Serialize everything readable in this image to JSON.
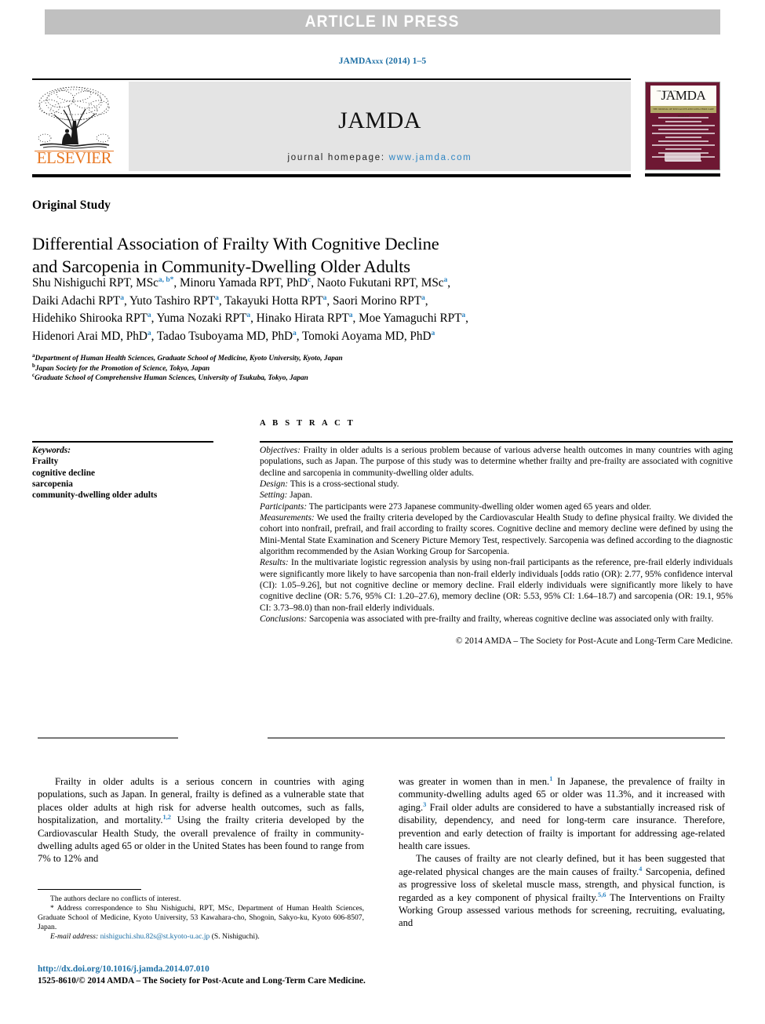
{
  "banner": {
    "text": "ARTICLE IN PRESS"
  },
  "citation": {
    "journal": "JAMDA",
    "volume": "xxx",
    "year": "(2014)",
    "pages": "1–5"
  },
  "masthead": {
    "publisher": "ELSEVIER",
    "journal_title": "JAMDA",
    "homepage_label": "journal homepage:",
    "homepage_url": "www.jamda.com"
  },
  "cover": {
    "title": "JAMDA",
    "top_caption": "THE JOURNAL OF",
    "band_caption": "THE JOURNAL OF POST-ACUTE AND LONG-TERM CARE MEDICINE",
    "logo_label": "jamda"
  },
  "article": {
    "section_type": "Original Study",
    "title_line1": "Differential Association of Frailty With Cognitive Decline",
    "title_line2": "and Sarcopenia in Community-Dwelling Older Adults"
  },
  "authors": {
    "line1_a": "Shu Nishiguchi RPT, MSc",
    "line1_a_sup": "a, b",
    "line1_a_star": "*",
    "line1_b": ", Minoru Yamada RPT, PhD",
    "line1_b_sup": "c",
    "line1_c": ", Naoto Fukutani RPT, MSc",
    "line1_c_sup": "a",
    "line1_end": ",",
    "line2_a": "Daiki Adachi RPT",
    "line2_a_sup": "a",
    "line2_b": ", Yuto Tashiro RPT",
    "line2_b_sup": "a",
    "line2_c": ", Takayuki Hotta RPT",
    "line2_c_sup": "a",
    "line2_d": ", Saori Morino RPT",
    "line2_d_sup": "a",
    "line2_end": ",",
    "line3_a": "Hidehiko Shirooka RPT",
    "line3_a_sup": "a",
    "line3_b": ", Yuma Nozaki RPT",
    "line3_b_sup": "a",
    "line3_c": ", Hinako Hirata RPT",
    "line3_c_sup": "a",
    "line3_d": ", Moe Yamaguchi RPT",
    "line3_d_sup": "a",
    "line3_end": ",",
    "line4_a": "Hidenori Arai MD, PhD",
    "line4_a_sup": "a",
    "line4_b": ", Tadao Tsuboyama MD, PhD",
    "line4_b_sup": "a",
    "line4_c": ", Tomoki Aoyama MD, PhD",
    "line4_c_sup": "a"
  },
  "affiliations": [
    {
      "mark": "a",
      "text": "Department of Human Health Sciences, Graduate School of Medicine, Kyoto University, Kyoto, Japan"
    },
    {
      "mark": "b",
      "text": "Japan Society for the Promotion of Science, Tokyo, Japan"
    },
    {
      "mark": "c",
      "text": "Graduate School of Comprehensive Human Sciences, University of Tsukuba, Tokyo, Japan"
    }
  ],
  "keywords": {
    "heading": "Keywords:",
    "items": [
      "Frailty",
      "cognitive decline",
      "sarcopenia",
      "community-dwelling older adults"
    ]
  },
  "abstract": {
    "heading": "A B S T R A C T",
    "objectives_label": "Objectives:",
    "objectives_text": " Frailty in older adults is a serious problem because of various adverse health outcomes in many countries with aging populations, such as Japan. The purpose of this study was to determine whether frailty and pre-frailty are associated with cognitive decline and sarcopenia in community-dwelling older adults.",
    "design_label": "Design:",
    "design_text": " This is a cross-sectional study.",
    "setting_label": "Setting:",
    "setting_text": " Japan.",
    "participants_label": "Participants:",
    "participants_text": " The participants were 273 Japanese community-dwelling older women aged 65 years and older.",
    "measurements_label": "Measurements:",
    "measurements_text": " We used the frailty criteria developed by the Cardiovascular Health Study to define physical frailty. We divided the cohort into nonfrail, prefrail, and frail according to frailty scores. Cognitive decline and memory decline were defined by using the Mini-Mental State Examination and Scenery Picture Memory Test, respectively. Sarcopenia was defined according to the diagnostic algorithm recommended by the Asian Working Group for Sarcopenia.",
    "results_label": "Results:",
    "results_text": " In the multivariate logistic regression analysis by using non-frail participants as the reference, pre-frail elderly individuals were significantly more likely to have sarcopenia than non-frail elderly individuals [odds ratio (OR): 2.77, 95% confidence interval (CI): 1.05–9.26], but not cognitive decline or memory decline. Frail elderly individuals were significantly more likely to have cognitive decline (OR: 5.76, 95% CI: 1.20–27.6), memory decline (OR: 5.53, 95% CI: 1.64–18.7) and sarcopenia (OR: 19.1, 95% CI: 3.73–98.0) than non-frail elderly individuals.",
    "conclusions_label": "Conclusions:",
    "conclusions_text": " Sarcopenia was associated with pre-frailty and frailty, whereas cognitive decline was associated only with frailty.",
    "copyright": "© 2014 AMDA – The Society for Post-Acute and Long-Term Care Medicine."
  },
  "body": {
    "left_p1_a": "Frailty in older adults is a serious concern in countries with aging populations, such as Japan. In general, frailty is defined as a vulnerable state that places older adults at high risk for adverse health outcomes, such as falls, hospitalization, and mortality.",
    "left_p1_sup1": "1,2",
    "left_p1_b": " Using the frailty criteria developed by the Cardiovascular Health Study, the overall prevalence of frailty in community-dwelling adults aged 65 or older in the United States has been found to range from 7% to 12% and",
    "right_p1_a": "was greater in women than in men.",
    "right_p1_sup1": "1",
    "right_p1_b": " In Japanese, the prevalence of frailty in community-dwelling adults aged 65 or older was 11.3%, and it increased with aging.",
    "right_p1_sup2": "3",
    "right_p1_c": " Frail older adults are considered to have a substantially increased risk of disability, dependency, and need for long-term care insurance. Therefore, prevention and early detection of frailty is important for addressing age-related health care issues.",
    "right_p2_a": "The causes of frailty are not clearly defined, but it has been suggested that age-related physical changes are the main causes of frailty.",
    "right_p2_sup1": "4",
    "right_p2_b": " Sarcopenia, defined as progressive loss of skeletal muscle mass, strength, and physical function, is regarded as a key component of physical frailty.",
    "right_p2_sup2": "5,6",
    "right_p2_c": " The Interventions on Frailty Working Group assessed various methods for screening, recruiting, evaluating, and"
  },
  "footnotes": {
    "conflicts": "The authors declare no conflicts of interest.",
    "star": "*",
    "correspondence": " Address correspondence to Shu Nishiguchi, RPT, MSc, Department of Human Health Sciences, Graduate School of Medicine, Kyoto University, 53 Kawahara-cho, Shogoin, Sakyo-ku, Kyoto 606-8507, Japan.",
    "email_label": "E-mail address:",
    "email": "nishiguchi.shu.82s@st.kyoto-u.ac.jp",
    "email_attrib": " (S. Nishiguchi).",
    "doi": "http://dx.doi.org/10.1016/j.jamda.2014.07.010",
    "issn": "1525-8610/© 2014 AMDA – The Society for Post-Acute and Long-Term Care Medicine."
  },
  "colors": {
    "link_blue": "#1c6ea4",
    "sup_blue": "#2f86c4",
    "elsevier_orange": "#E87722",
    "banner_gray": "#c0c0c0",
    "masthead_gray": "#e4e4e4",
    "cover_maroon": "#6e1833"
  }
}
